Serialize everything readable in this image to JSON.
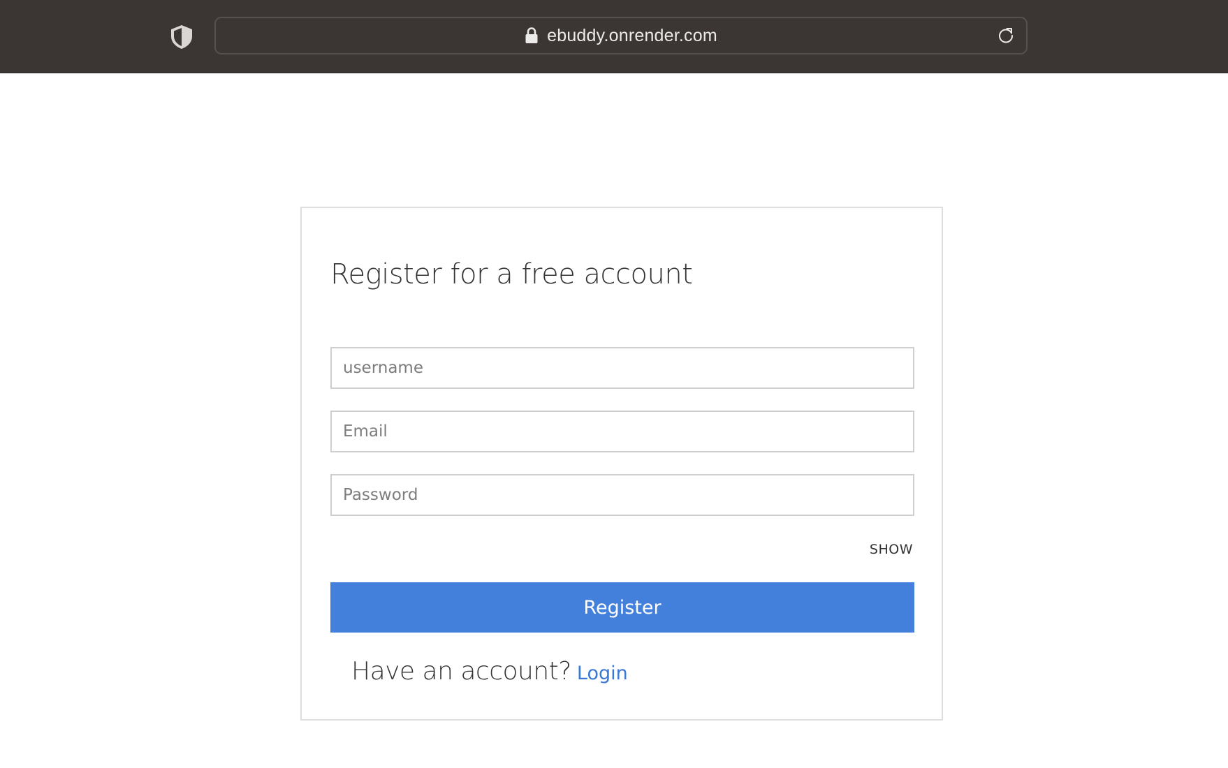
{
  "browser": {
    "url": "ebuddy.onrender.com",
    "icons": {
      "privacy": "shield-icon",
      "secure": "lock-icon",
      "reload": "reload-icon"
    }
  },
  "form": {
    "title": "Register for a free account",
    "username_placeholder": "username",
    "email_placeholder": "Email",
    "password_placeholder": "Password",
    "show_label": "SHOW",
    "register_label": "Register",
    "login_prompt": "Have an account?",
    "login_link": "Login"
  },
  "colors": {
    "browser_chrome": "#3b3633",
    "primary_button": "#4380dc",
    "link": "#3a78d6"
  }
}
